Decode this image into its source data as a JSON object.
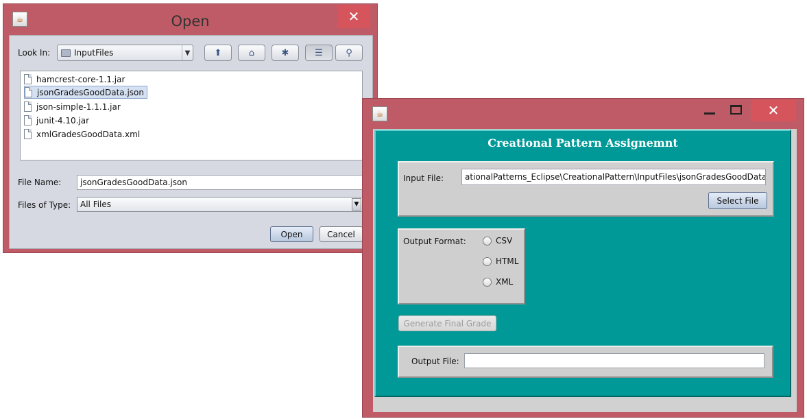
{
  "open_dialog": {
    "title": "Open",
    "look_in_label": "Look In:",
    "look_in_value": "InputFiles",
    "files": [
      {
        "name": "hamcrest-core-1.1.jar",
        "selected": false
      },
      {
        "name": "jsonGradesGoodData.json",
        "selected": true
      },
      {
        "name": "json-simple-1.1.1.jar",
        "selected": false
      },
      {
        "name": "junit-4.10.jar",
        "selected": false
      },
      {
        "name": "xmlGradesGoodData.xml",
        "selected": false
      }
    ],
    "file_name_label": "File Name:",
    "file_name_value": "jsonGradesGoodData.json",
    "files_of_type_label": "Files of Type:",
    "files_of_type_value": "All Files",
    "open_button": "Open",
    "cancel_button": "Cancel",
    "toolbar_icons": [
      "up-folder-icon",
      "home-icon",
      "new-folder-icon",
      "list-view-icon",
      "details-view-icon"
    ]
  },
  "app_window": {
    "heading": "Creational Pattern Assignemnt",
    "input_file_label": "Input File:",
    "input_file_value": "ationalPatterns_Eclipse\\CreationalPattern\\InputFiles\\jsonGradesGoodData.json",
    "select_file_button": "Select File",
    "output_format_label": "Output Format:",
    "format_options": [
      "CSV",
      "HTML",
      "XML"
    ],
    "generate_button": "Generate Final Grade",
    "output_file_label": "Output File:",
    "output_file_value": ""
  },
  "colors": {
    "window_frame": "#be5b66",
    "close_button": "#d6555d",
    "teal_panel": "#009997",
    "dialog_background": "#d6d9e1",
    "gray_panel": "#cfcfcf",
    "selection": "#d5e1f2"
  }
}
